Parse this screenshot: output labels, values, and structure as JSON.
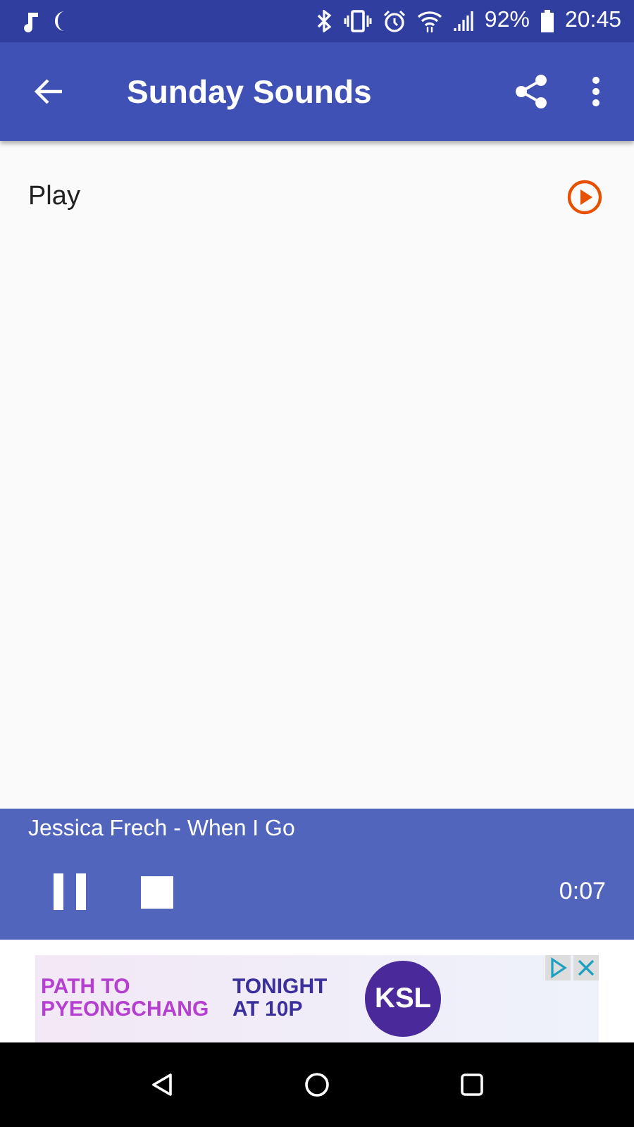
{
  "status_bar": {
    "battery": "92%",
    "time": "20:45"
  },
  "app_bar": {
    "title": "Sunday Sounds"
  },
  "items": [
    {
      "label": "Play"
    }
  ],
  "player": {
    "track": "Jessica Frech - When I Go",
    "elapsed": "0:07"
  },
  "ad": {
    "headline": "PATH TO PYEONGCHANG",
    "tagline": "TONIGHT AT 10P",
    "logo": "KSL"
  }
}
